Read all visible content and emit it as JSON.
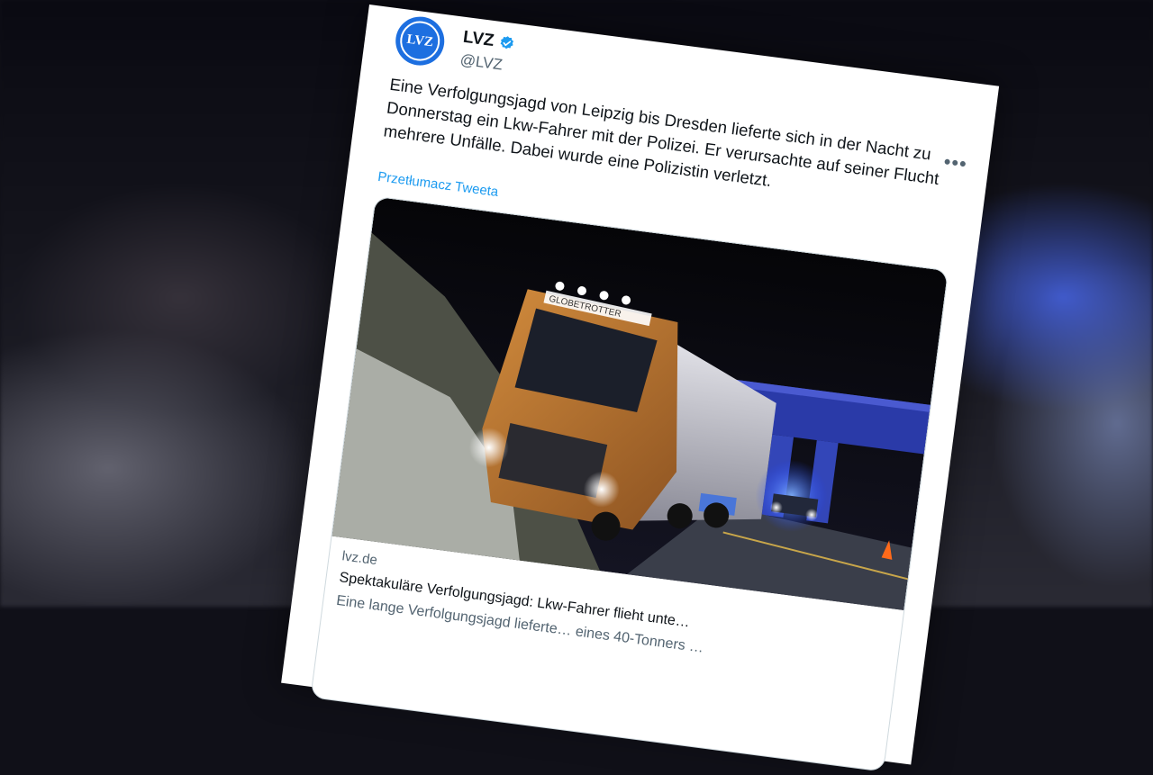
{
  "account": {
    "avatar_text": "LVZ",
    "name": "LVZ",
    "handle": "@LVZ",
    "verified_color": "#1d9bf0"
  },
  "menu": {
    "more_label": "•••"
  },
  "tweet": {
    "text": "Eine Verfolgungsjagd von Leipzig bis Dresden lieferte sich in der Nacht zu Donnerstag ein Lkw-Fahrer mit der Polizei. Er verursachte auf seiner Flucht mehrere Unfälle. Dabei wurde eine Polizistin verletzt.",
    "translate_label": "Przetłumacz Tweeta"
  },
  "link_card": {
    "photo_truck_lettering": "GLOBETROTTER",
    "domain": "lvz.de",
    "title": "Spektakuläre Verfolgungsjagd: Lkw-Fahrer flieht unte…",
    "description": "Eine lange Verfolgungsjagd lieferte… eines 40-Tonners …"
  }
}
